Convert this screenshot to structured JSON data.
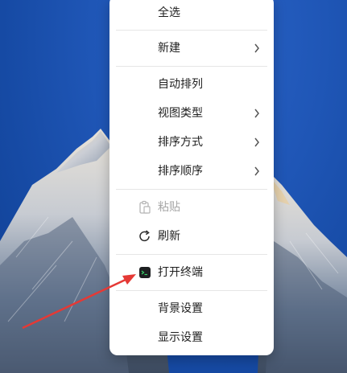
{
  "context_menu": {
    "items": [
      {
        "label": "全选"
      },
      {
        "label": "新建",
        "submenu": true
      },
      {
        "label": "自动排列"
      },
      {
        "label": "视图类型",
        "submenu": true
      },
      {
        "label": "排序方式",
        "submenu": true
      },
      {
        "label": "排序顺序",
        "submenu": true
      },
      {
        "label": "粘贴",
        "disabled": true,
        "icon": "paste-icon"
      },
      {
        "label": "刷新",
        "icon": "refresh-icon"
      },
      {
        "label": "打开终端",
        "icon": "terminal-icon"
      },
      {
        "label": "背景设置"
      },
      {
        "label": "显示设置"
      }
    ]
  },
  "annotation": {
    "color": "#e53935"
  }
}
